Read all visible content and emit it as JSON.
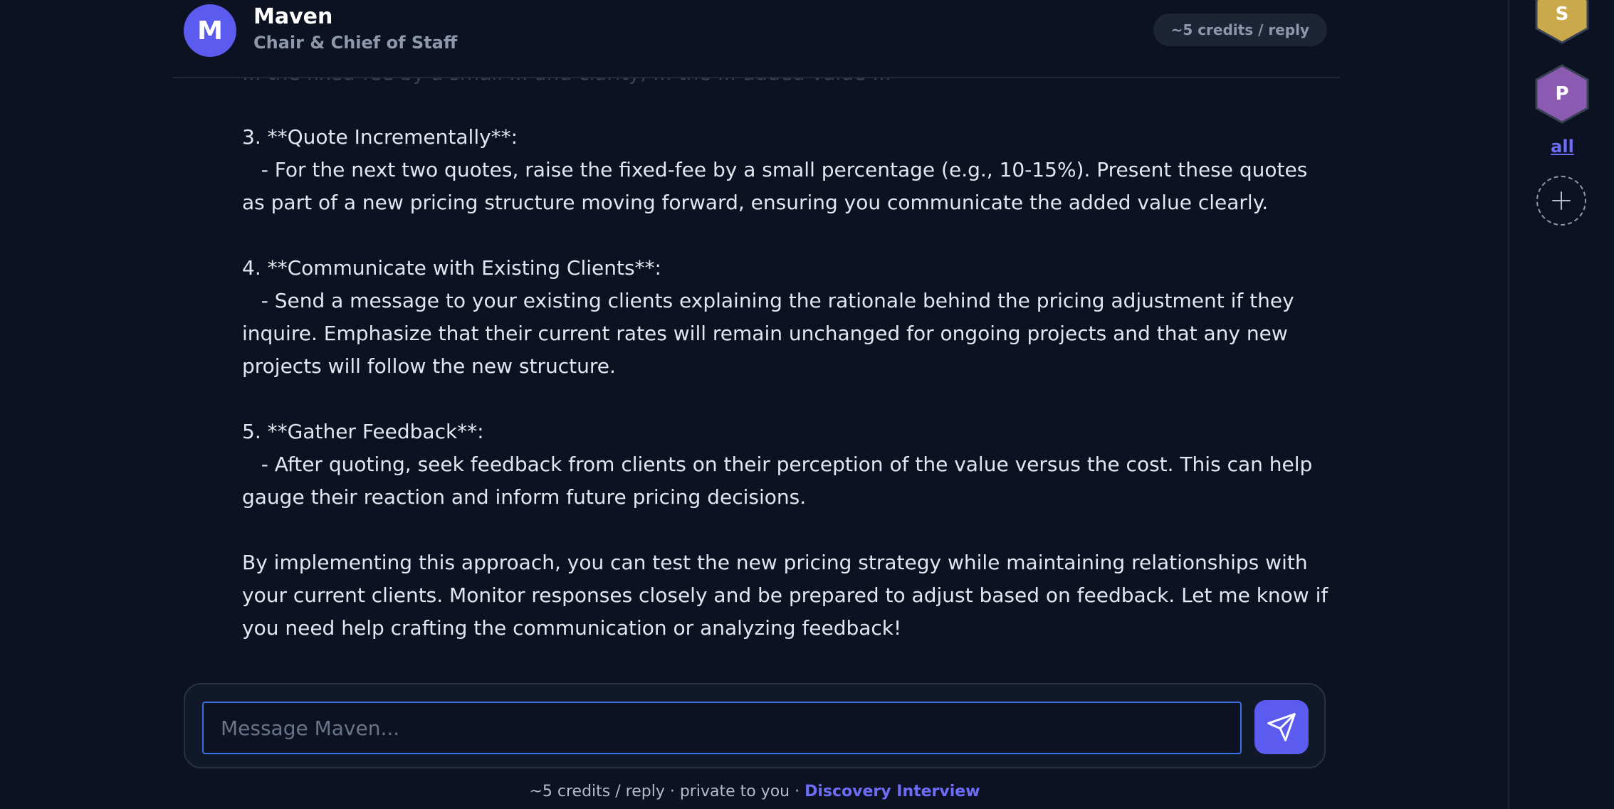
{
  "header": {
    "avatar_letter": "M",
    "agent_name": "Maven",
    "agent_role": "Chair & Chief of Staff",
    "credits_label": "~5 credits / reply"
  },
  "messages": {
    "faded_text": "... the fixed-fee by a small ... and clarity, ... the ... added value ...",
    "body": "3. **Quote Incrementally**:\n   - For the next two quotes, raise the fixed-fee by a small percentage (e.g., 10-15%). Present these quotes as part of a new pricing structure moving forward, ensuring you communicate the added value clearly.\n\n4. **Communicate with Existing Clients**:\n   - Send a message to your existing clients explaining the rationale behind the pricing adjustment if they inquire. Emphasize that their current rates will remain unchanged for ongoing projects and that any new projects will follow the new structure.\n\n5. **Gather Feedback**:\n   - After quoting, seek feedback from clients on their perception of the value versus the cost. This can help gauge their reaction and inform future pricing decisions.\n\nBy implementing this approach, you can test the new pricing strategy while maintaining relationships with your current clients. Monitor responses closely and be prepared to adjust based on feedback. Let me know if you need help crafting the communication or analyzing feedback!"
  },
  "composer": {
    "placeholder": "Message Maven...",
    "value": "",
    "send_icon": "paper-plane-icon"
  },
  "footer": {
    "note": "~5 credits / reply · private to you · ",
    "link_label": "Discovery Interview"
  },
  "rail": {
    "items": [
      {
        "letter": "S",
        "color": "#c9a94a"
      },
      {
        "letter": "P",
        "color": "#8a5bb0"
      }
    ],
    "all_label": "all",
    "add_icon": "plus-icon"
  },
  "colors": {
    "background": "#0c1222",
    "accent": "#5b5bf0",
    "link": "#6d6df5"
  }
}
